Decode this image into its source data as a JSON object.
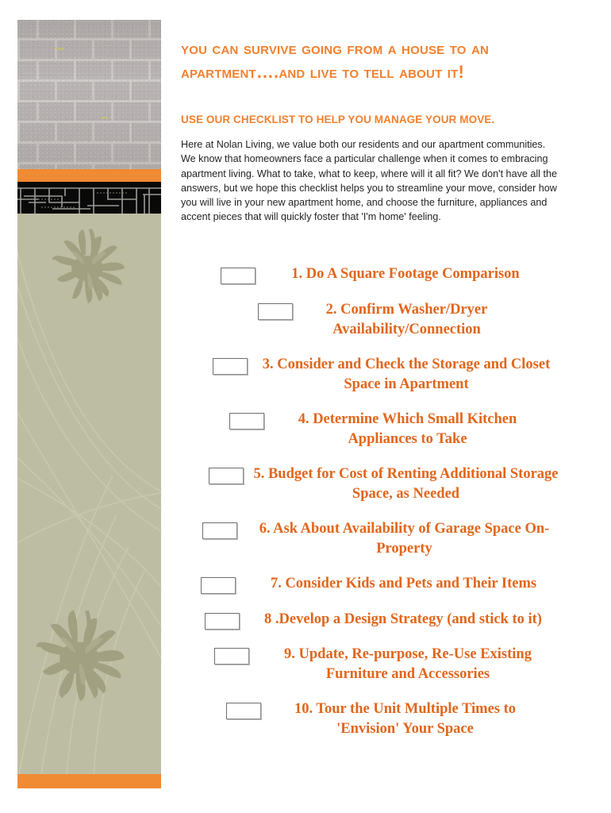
{
  "document": {
    "headline": "You Can Survive Going From a House to an Apartment….and live to tell about it!",
    "subhead": "USE OUR CHECKLIST TO HELP YOU MANAGE YOUR MOVE.",
    "intro": "Here at Nolan Living, we value both our residents and our apartment communities.  We know that homeowners face a particular challenge when it comes to embracing apartment living.  What to take, what to keep, where will it all fit?  We don't have all the answers, but we hope this checklist helps you to streamline your move, consider how you will live in your new apartment home, and choose the furniture, appliances and accent pieces that will quickly foster that 'I'm home' feeling."
  },
  "colors": {
    "orange_heading": "#F2802E",
    "orange_band": "#F08A33",
    "orange_checklist": "#E1661B",
    "sage": "#BDBDA3",
    "sage_motif": "#A1A081",
    "brick_grey": "#B8B3B2",
    "body_text": "#231F20",
    "black_band": "#090909"
  },
  "sidebar": {
    "brick_panel": "brick-wall-photo",
    "band_top": "orange-divider-band",
    "geometric_band": "black-geometric-line-pattern",
    "sage_panel": "sage-green-floral-panel",
    "band_bottom": "orange-divider-band",
    "motifs": [
      "chrysanthemum-silhouette-upper",
      "chrysanthemum-silhouette-lower"
    ]
  },
  "checklist": {
    "items": [
      {
        "number": "1.",
        "text": "1. Do A Square Footage Comparison",
        "indent": 50,
        "checkbox": "checkbox-1"
      },
      {
        "number": "2.",
        "text": "2. Confirm Washer/Dryer Availability/Connection",
        "indent": 97,
        "checkbox": "checkbox-2"
      },
      {
        "number": "3.",
        "text": "3. Consider and Check the Storage and Closet Space in Apartment",
        "indent": 40,
        "checkbox": "checkbox-3"
      },
      {
        "number": "4.",
        "text": "4. Determine Which Small Kitchen Appliances to Take",
        "indent": 61,
        "checkbox": "checkbox-4"
      },
      {
        "number": "5.",
        "text": "5. Budget for Cost of Renting Additional Storage Space, as Needed",
        "indent": 35,
        "checkbox": "checkbox-5"
      },
      {
        "number": "6.",
        "text": "6. Ask About Availability of Garage Space On-Property",
        "indent": 27,
        "checkbox": "checkbox-6"
      },
      {
        "number": "7.",
        "text": "7. Consider Kids and Pets and Their Items",
        "indent": 25,
        "checkbox": "checkbox-7"
      },
      {
        "number": "8",
        "text": "8 .Develop a Design Strategy (and stick to it)",
        "indent": 30,
        "checkbox": "checkbox-8"
      },
      {
        "number": "9.",
        "text": "9. Update, Re-purpose, Re-Use Existing Furniture and Accessories",
        "indent": 42,
        "checkbox": "checkbox-9"
      },
      {
        "number": "10.",
        "text": "10. Tour the Unit Multiple Times to 'Envision' Your Space",
        "indent": 57,
        "checkbox": "checkbox-10"
      }
    ]
  }
}
